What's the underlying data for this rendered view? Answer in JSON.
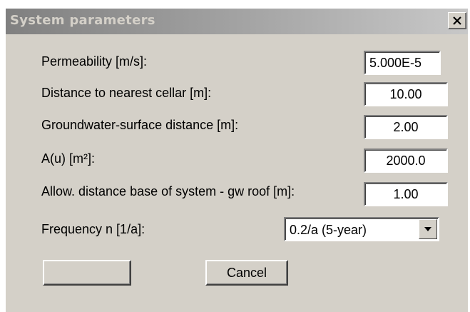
{
  "window": {
    "title": "System parameters",
    "close_icon": "close-icon"
  },
  "parameters": [
    {
      "label": "Permeability [m/s]:",
      "value": "5.000E-5"
    },
    {
      "label": "Distance to nearest cellar [m]:",
      "value": "10.00"
    },
    {
      "label": "Groundwater-surface distance [m]:",
      "value": "2.00"
    },
    {
      "label": "A(u) [m²]:",
      "value": "2000.0"
    },
    {
      "label": "Allow. distance base of system - gw roof [m]:",
      "value": "1.00"
    }
  ],
  "frequency": {
    "label": "Frequency n [1/a]:",
    "selected": "0.2/a (5-year)",
    "arrow_icon": "chevron-down-icon"
  },
  "buttons": {
    "ok_label": "",
    "cancel_label": "Cancel"
  },
  "colors": {
    "dialog_bg": "#d4d0c8",
    "titlebar_start": "#808080",
    "titlebar_end": "#c8c8c8"
  }
}
